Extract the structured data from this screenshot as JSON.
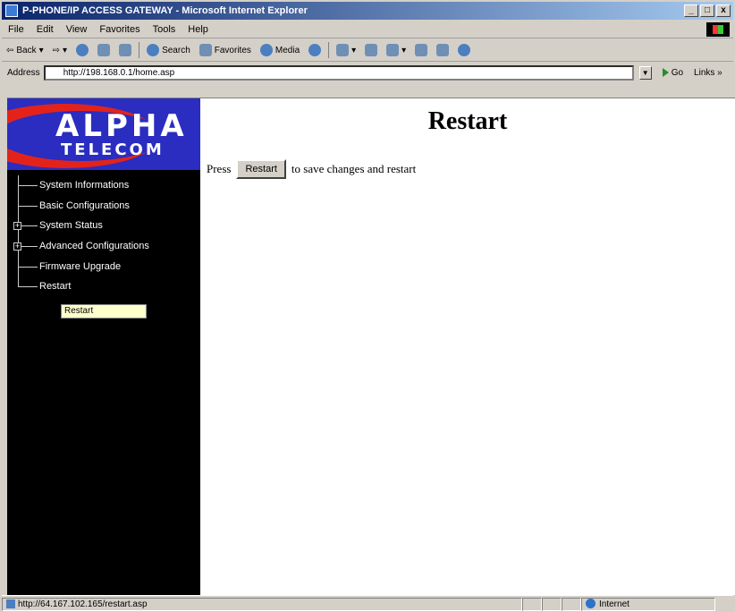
{
  "window": {
    "title": "P-PHONE/IP ACCESS GATEWAY - Microsoft Internet Explorer",
    "minimize": "_",
    "maximize": "□",
    "close": "x"
  },
  "menubar": {
    "items": [
      "File",
      "Edit",
      "View",
      "Favorites",
      "Tools",
      "Help"
    ]
  },
  "toolbar": {
    "back": "Back",
    "search": "Search",
    "favorites": "Favorites",
    "media": "Media"
  },
  "addressbar": {
    "label": "Address",
    "url": "http://198.168.0.1/home.asp",
    "go": "Go",
    "links": "Links »"
  },
  "logo": {
    "line1": "ALPHA",
    "line2": "TELECOM"
  },
  "nav": {
    "items": [
      {
        "label": "System Informations",
        "expandable": false
      },
      {
        "label": "Basic Configurations",
        "expandable": false
      },
      {
        "label": "System Status",
        "expandable": true
      },
      {
        "label": "Advanced Configurations",
        "expandable": true
      },
      {
        "label": "Firmware Upgrade",
        "expandable": false
      },
      {
        "label": "Restart",
        "expandable": false
      }
    ],
    "tooltip": "Restart",
    "expander_symbol": "+"
  },
  "main": {
    "title": "Restart",
    "press_prefix": "Press",
    "button_label": "Restart",
    "press_suffix": "to save changes and restart"
  },
  "statusbar": {
    "url": "http://64.167.102.165/restart.asp",
    "zone": "Internet"
  }
}
